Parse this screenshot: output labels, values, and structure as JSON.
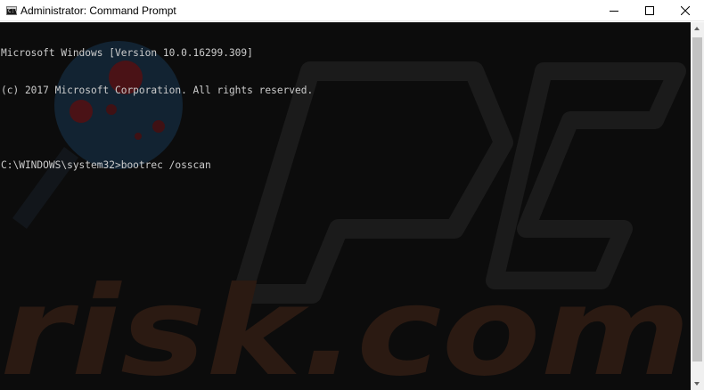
{
  "window": {
    "title": "Administrator: Command Prompt",
    "icon": "cmd-icon",
    "icon_text": "C:\\"
  },
  "controls": {
    "minimize_icon": "minimize-icon",
    "maximize_icon": "maximize-icon",
    "close_icon": "close-icon"
  },
  "console": {
    "lines": [
      "Microsoft Windows [Version 10.0.16299.309]",
      "(c) 2017 Microsoft Corporation. All rights reserved.",
      "",
      "C:\\WINDOWS\\system32>bootrec /osscan"
    ],
    "background": "#0c0c0c",
    "foreground": "#cccccc"
  },
  "watermark": {
    "text": "risk.com"
  }
}
